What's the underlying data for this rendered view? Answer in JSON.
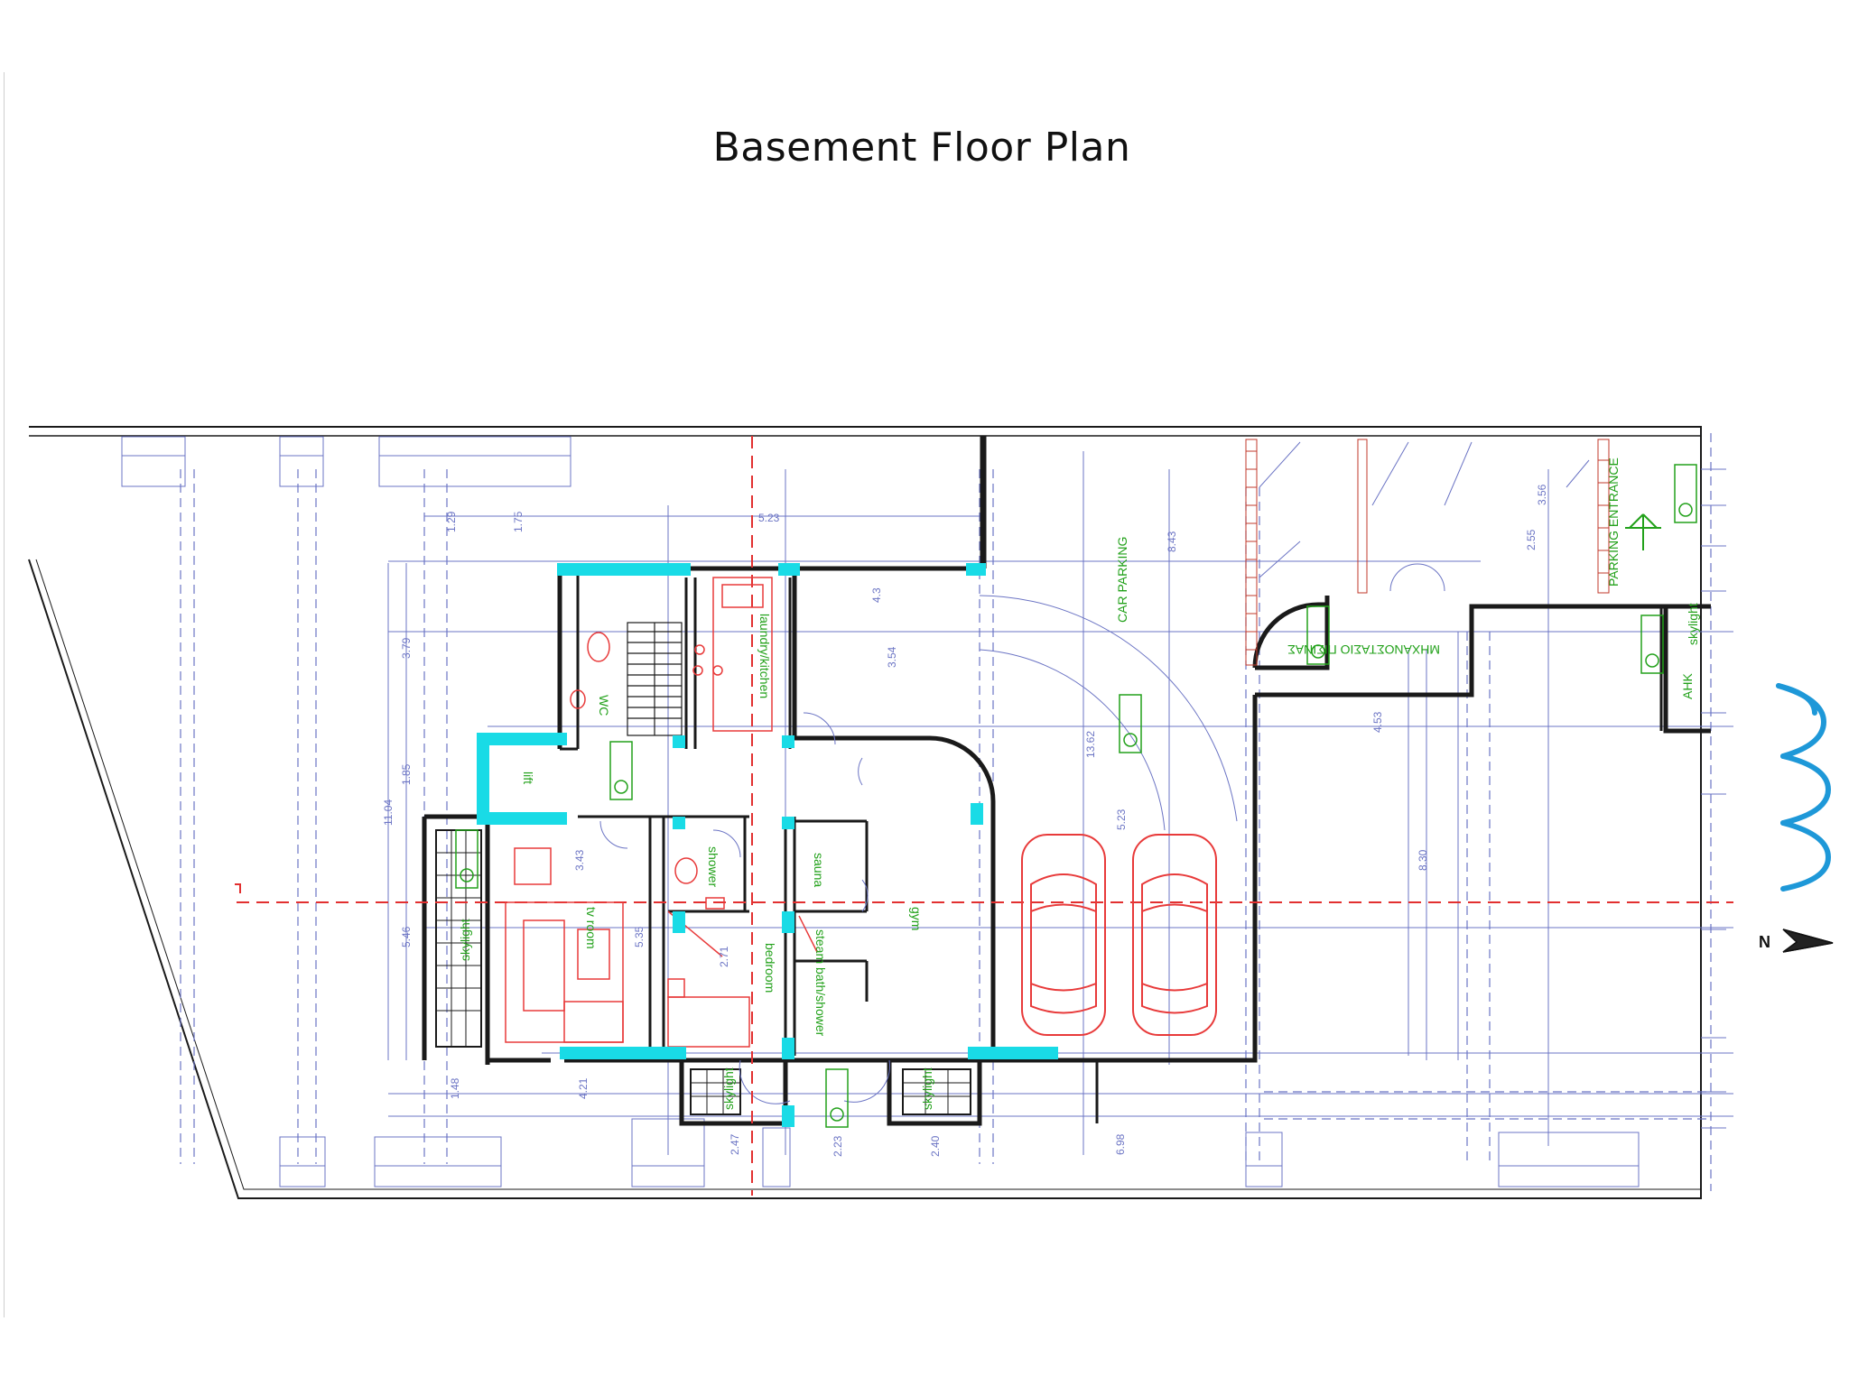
{
  "title": "Basement Floor Plan",
  "rooms": {
    "tv_room": "tv room",
    "bedroom": "bedroom",
    "gym": "gym",
    "sauna": "sauna",
    "steam_bath_shower": "steam bath/shower",
    "laundry_kitchen": "laundry/kitchen",
    "wc": "WC",
    "lift": "lift",
    "shower": "shower",
    "car_parking": "CAR PARKING",
    "parking_entrance": "PARKING ENTRANCE",
    "skylight": "skylight",
    "mechanical_room": "ΜΗΧΑΝΟΣΤΑΣΙΟ ΠΙΣΙΝΑΣ",
    "ahk": "AHK"
  },
  "dimensions": [
    "5.23",
    "3.79",
    "1.85",
    "11.04",
    "5.46",
    "5.35",
    "3.43",
    "2.71",
    "1.48",
    "4.21",
    "2.47",
    "2.23",
    "2.40",
    "6.98",
    "8.43",
    "13.62",
    "5.23",
    "4.53",
    "8.30",
    "3.56",
    "2.55",
    "3.54",
    "4.3",
    "1.29",
    "1.75"
  ],
  "north_label": "N",
  "colors": {
    "walls": "#1a1a1a",
    "grid": "#6b74c4",
    "section_line": "#e23030",
    "columns": "#19dbe6",
    "labels": "#22a11a",
    "furniture": "#e83a3a",
    "waves": "#1e98d8"
  }
}
